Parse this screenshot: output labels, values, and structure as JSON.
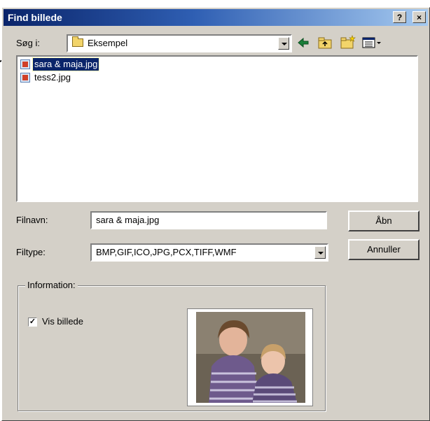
{
  "dialog": {
    "title": "Find billede",
    "help_label": "?",
    "close_label": "×"
  },
  "lookin": {
    "label": "Søg i:",
    "value": "Eksempel"
  },
  "files": [
    {
      "name": "sara & maja.jpg",
      "selected": true
    },
    {
      "name": "tess2.jpg",
      "selected": false
    }
  ],
  "filename": {
    "label": "Filnavn:",
    "value": "sara & maja.jpg"
  },
  "filetype": {
    "label": "Filtype:",
    "value": "BMP,GIF,ICO,JPG,PCX,TIFF,WMF"
  },
  "buttons": {
    "open": "Åbn",
    "cancel": "Annuller"
  },
  "information": {
    "legend": "Information:",
    "show_image_label": "Vis billede",
    "show_image_checked": true
  },
  "icons": {
    "back": "back-arrow-icon",
    "up": "up-folder-icon",
    "new_folder": "new-folder-icon",
    "views": "view-menu-icon"
  },
  "colors": {
    "title_start": "#0a246a",
    "title_end": "#a6caf0",
    "face": "#d4d0c8",
    "selection": "#0a246a"
  }
}
